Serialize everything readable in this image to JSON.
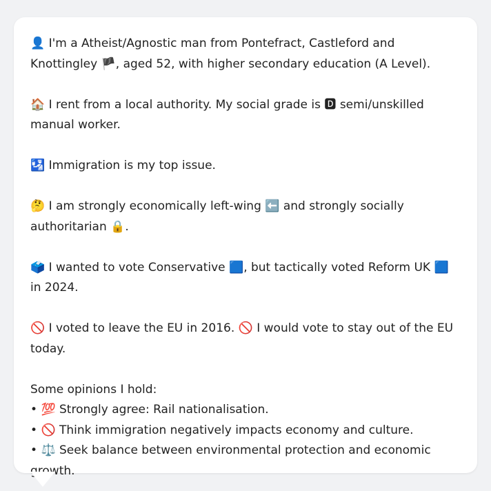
{
  "profile": {
    "p1": {
      "icon": "👤",
      "text": " I'm a Atheist/Agnostic man from Pontefract, Castleford and Knottingley ",
      "flag": "🏴",
      "text2": ", aged 52, with higher secondary education (A Level)."
    },
    "p2": {
      "icon": "🏠",
      "text": " I rent from a local authority. My social grade is ",
      "badge": "🅳",
      "text2": " semi/unskilled manual worker."
    },
    "p3": {
      "icon": "🛂",
      "text": " Immigration is my top issue."
    },
    "p4": {
      "icon": "🤔",
      "text": " I am strongly economically left-wing ",
      "arrow": "⬅️",
      "text2": " and strongly socially authoritarian ",
      "lock": "🔒",
      "text3": "."
    },
    "p5": {
      "icon": "🗳️",
      "text": " I wanted to vote Conservative ",
      "sq1": "🟦",
      "text2": ", but tactically voted Reform UK ",
      "sq2": "🟦",
      "text3": " in 2024."
    },
    "p6": {
      "icon": "🚫",
      "text": " I voted to leave the EU in 2016. ",
      "icon2": "🚫",
      "text2": " I would vote to stay out of the EU today."
    }
  },
  "opinions": {
    "heading": "Some opinions I hold:",
    "items": [
      {
        "bullet": "•",
        "icon": "💯",
        "text": " Strongly agree: Rail nationalisation."
      },
      {
        "bullet": "•",
        "icon": "🚫",
        "text": " Think immigration negatively impacts economy and culture."
      },
      {
        "bullet": "•",
        "icon": "⚖️",
        "text": " Seek balance between environmental protection and economic growth."
      }
    ]
  }
}
